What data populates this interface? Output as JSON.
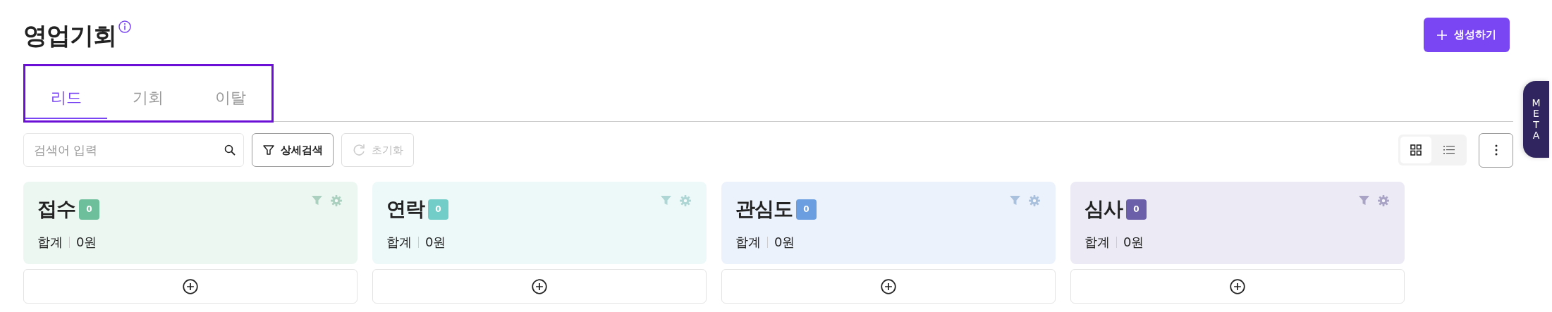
{
  "header": {
    "title": "영업기회",
    "create_button": "생성하기"
  },
  "tabs": [
    {
      "label": "리드",
      "selected": true
    },
    {
      "label": "기회",
      "selected": false
    },
    {
      "label": "이탈",
      "selected": false
    }
  ],
  "toolbar": {
    "search": {
      "placeholder": "검색어 입력"
    },
    "detail_search": "상세검색",
    "reset": {
      "label": "초기화",
      "disabled": true
    },
    "view": [
      {
        "kind": "grid",
        "selected": true
      },
      {
        "kind": "list",
        "selected": false
      }
    ]
  },
  "side_tab": "META",
  "columns": [
    {
      "title": "접수",
      "count": "0",
      "color": "#6dbf9c",
      "total_label": "합계",
      "total": "0원"
    },
    {
      "title": "연락",
      "count": "0",
      "color": "#72cdc8",
      "total_label": "합계",
      "total": "0원"
    },
    {
      "title": "관심도",
      "count": "0",
      "color": "#6b9ee0",
      "total_label": "합계",
      "total": "0원"
    },
    {
      "title": "심사",
      "count": "0",
      "color": "#6a5fa8",
      "total_label": "합계",
      "total": "0원"
    }
  ]
}
